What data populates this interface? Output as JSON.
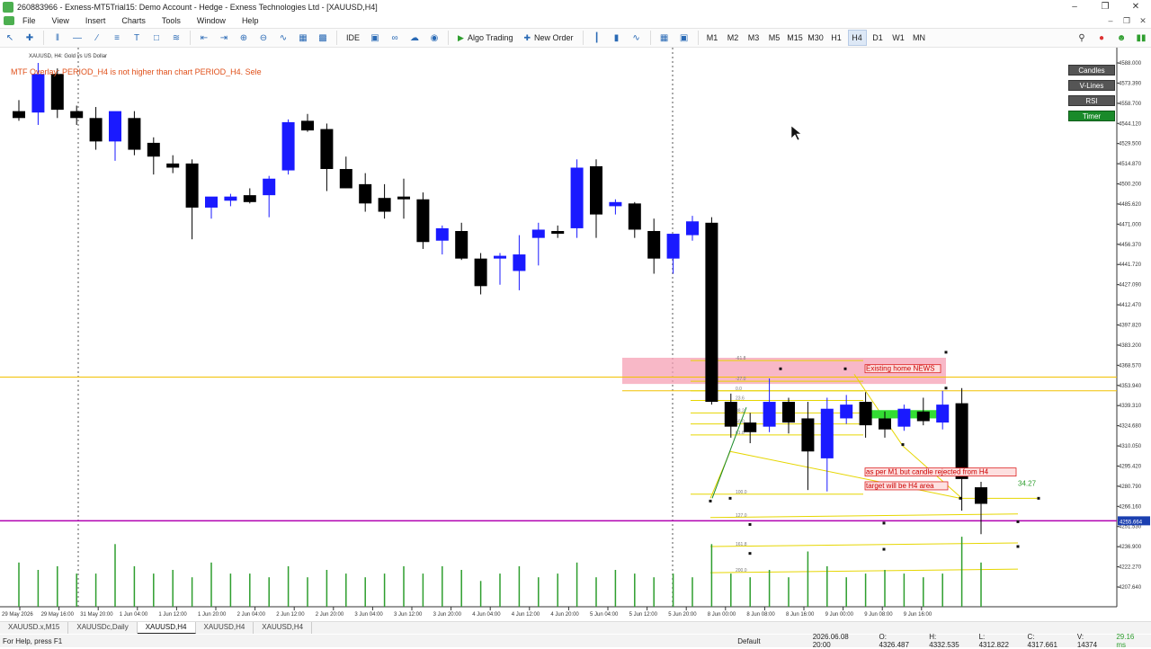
{
  "window": {
    "title": "260883966 - Exness-MT5Trial15: Demo Account - Hedge - Exness Technologies Ltd - [XAUUSD,H4]"
  },
  "menu": [
    "File",
    "View",
    "Insert",
    "Charts",
    "Tools",
    "Window",
    "Help"
  ],
  "toolbar": {
    "algo_trading": "Algo Trading",
    "new_order": "New Order",
    "ide": "IDE",
    "timeframes": [
      "M1",
      "M2",
      "M3",
      "M5",
      "M15",
      "M30",
      "H1",
      "H4",
      "D1",
      "W1",
      "MN"
    ],
    "active_tf": "H4"
  },
  "chart": {
    "symbol_label": "XAUUSD, H4:  Gold vs US Dollar",
    "warning": "MTF Overlay: PERIOD_H4 is not higher than chart PERIOD_H4. Sele",
    "colors": {
      "bull": "#1a1aff",
      "bear": "#000000",
      "price_line": "#b000b0",
      "zone": "#f5a0b4",
      "fib": "#e6d600",
      "volume": "#2e9e2e"
    },
    "indicator_buttons": [
      "Candles",
      "V-Lines",
      "RSI",
      "Timer"
    ],
    "current_price": "4255.664",
    "annotations": [
      "Existing home NEWS",
      "as per M1 but candle rejected from H4",
      "target will be H4 area",
      "34.27"
    ],
    "price_axis": [
      "4588.000",
      "4573.390",
      "4558.700",
      "4544.120",
      "4529.500",
      "4514.870",
      "4500.200",
      "4485.620",
      "4471.000",
      "4456.370",
      "4441.720",
      "4427.090",
      "4412.470",
      "4397.820",
      "4383.200",
      "4368.570",
      "4353.940",
      "4339.310",
      "4324.680",
      "4310.050",
      "4295.420",
      "4280.790",
      "4266.160",
      "4251.530",
      "4236.900",
      "4222.270",
      "4207.640"
    ],
    "time_axis": [
      "29 May 2026",
      "29 May 16:00",
      "31 May 20:00",
      "1 Jun 04:00",
      "1 Jun 12:00",
      "1 Jun 20:00",
      "2 Jun 04:00",
      "2 Jun 12:00",
      "2 Jun 20:00",
      "3 Jun 04:00",
      "3 Jun 12:00",
      "3 Jun 20:00",
      "4 Jun 04:00",
      "4 Jun 12:00",
      "4 Jun 20:00",
      "5 Jun 04:00",
      "5 Jun 12:00",
      "5 Jun 20:00",
      "8 Jun 00:00",
      "8 Jun 08:00",
      "8 Jun 16:00",
      "9 Jun 00:00",
      "9 Jun 08:00",
      "9 Jun 16:00"
    ],
    "fib_labels": [
      "-61.8",
      "-27.0",
      "0.0",
      "23.6",
      "38.2",
      "50.0",
      "61.8",
      "100.0",
      "127.0",
      "161.8",
      "200.0"
    ],
    "candles": [
      {
        "o": 4553,
        "h": 4561,
        "l": 4546,
        "c": 4548
      },
      {
        "o": 4552,
        "h": 4588,
        "l": 4543,
        "c": 4580
      },
      {
        "o": 4580,
        "h": 4584,
        "l": 4548,
        "c": 4554
      },
      {
        "o": 4553,
        "h": 4557,
        "l": 4543,
        "c": 4548
      },
      {
        "o": 4548,
        "h": 4556,
        "l": 4525,
        "c": 4531
      },
      {
        "o": 4531,
        "h": 4552,
        "l": 4517,
        "c": 4553
      },
      {
        "o": 4548,
        "h": 4553,
        "l": 4521,
        "c": 4525
      },
      {
        "o": 4530,
        "h": 4534,
        "l": 4507,
        "c": 4520
      },
      {
        "o": 4515,
        "h": 4521,
        "l": 4508,
        "c": 4512
      },
      {
        "o": 4515,
        "h": 4518,
        "l": 4460,
        "c": 4483
      },
      {
        "o": 4483,
        "h": 4490,
        "l": 4475,
        "c": 4491
      },
      {
        "o": 4488,
        "h": 4493,
        "l": 4484,
        "c": 4491
      },
      {
        "o": 4492,
        "h": 4497,
        "l": 4486,
        "c": 4487
      },
      {
        "o": 4492,
        "h": 4506,
        "l": 4476,
        "c": 4504
      },
      {
        "o": 4510,
        "h": 4547,
        "l": 4507,
        "c": 4545
      },
      {
        "o": 4546,
        "h": 4551,
        "l": 4538,
        "c": 4539
      },
      {
        "o": 4540,
        "h": 4544,
        "l": 4495,
        "c": 4511
      },
      {
        "o": 4511,
        "h": 4520,
        "l": 4497,
        "c": 4497
      },
      {
        "o": 4500,
        "h": 4508,
        "l": 4480,
        "c": 4486
      },
      {
        "o": 4490,
        "h": 4500,
        "l": 4475,
        "c": 4480
      },
      {
        "o": 4491,
        "h": 4504,
        "l": 4475,
        "c": 4489
      },
      {
        "o": 4489,
        "h": 4494,
        "l": 4453,
        "c": 4458
      },
      {
        "o": 4459,
        "h": 4470,
        "l": 4449,
        "c": 4468
      },
      {
        "o": 4466,
        "h": 4472,
        "l": 4445,
        "c": 4446
      },
      {
        "o": 4446,
        "h": 4450,
        "l": 4420,
        "c": 4426
      },
      {
        "o": 4446,
        "h": 4450,
        "l": 4427,
        "c": 4448
      },
      {
        "o": 4437,
        "h": 4463,
        "l": 4423,
        "c": 4449
      },
      {
        "o": 4461,
        "h": 4472,
        "l": 4441,
        "c": 4467
      },
      {
        "o": 4466,
        "h": 4470,
        "l": 4461,
        "c": 4464
      },
      {
        "o": 4468,
        "h": 4518,
        "l": 4461,
        "c": 4512
      },
      {
        "o": 4513,
        "h": 4518,
        "l": 4461,
        "c": 4478
      },
      {
        "o": 4484,
        "h": 4489,
        "l": 4478,
        "c": 4487
      },
      {
        "o": 4486,
        "h": 4487,
        "l": 4461,
        "c": 4467
      },
      {
        "o": 4466,
        "h": 4475,
        "l": 4435,
        "c": 4446
      },
      {
        "o": 4446,
        "h": 4462,
        "l": 4435,
        "c": 4464
      },
      {
        "o": 4463,
        "h": 4477,
        "l": 4459,
        "c": 4473
      },
      {
        "o": 4472,
        "h": 4476,
        "l": 4340,
        "c": 4342
      },
      {
        "o": 4342,
        "h": 4348,
        "l": 4316,
        "c": 4324
      },
      {
        "o": 4327,
        "h": 4334,
        "l": 4312,
        "c": 4320
      },
      {
        "o": 4324,
        "h": 4359,
        "l": 4320,
        "c": 4342
      },
      {
        "o": 4342,
        "h": 4345,
        "l": 4319,
        "c": 4327
      },
      {
        "o": 4330,
        "h": 4342,
        "l": 4278,
        "c": 4306
      },
      {
        "o": 4301,
        "h": 4345,
        "l": 4277,
        "c": 4337
      },
      {
        "o": 4330,
        "h": 4347,
        "l": 4326,
        "c": 4340
      },
      {
        "o": 4342,
        "h": 4349,
        "l": 4316,
        "c": 4325
      },
      {
        "o": 4330,
        "h": 4335,
        "l": 4316,
        "c": 4322
      },
      {
        "o": 4324,
        "h": 4340,
        "l": 4321,
        "c": 4337
      },
      {
        "o": 4335,
        "h": 4345,
        "l": 4325,
        "c": 4328
      },
      {
        "o": 4327,
        "h": 4350,
        "l": 4322,
        "c": 4340
      },
      {
        "o": 4341,
        "h": 4352,
        "l": 4263,
        "c": 4286
      },
      {
        "o": 4280,
        "h": 4284,
        "l": 4246,
        "c": 4268
      }
    ],
    "volumes": [
      60,
      50,
      55,
      45,
      45,
      85,
      55,
      45,
      50,
      40,
      60,
      45,
      45,
      40,
      55,
      40,
      50,
      45,
      40,
      45,
      55,
      45,
      55,
      50,
      35,
      45,
      55,
      40,
      45,
      60,
      40,
      50,
      45,
      40,
      45,
      40,
      85,
      45,
      40,
      50,
      40,
      75,
      55,
      40,
      45,
      50,
      45,
      40,
      45,
      95,
      60
    ]
  },
  "tabs": [
    "XAUUSD.x,M15",
    "XAUUSDc,Daily",
    "XAUUSD,H4",
    "XAUUSD,H4",
    "XAUUSD,H4"
  ],
  "active_tab": 2,
  "status": {
    "help": "For Help, press F1",
    "profile": "Default",
    "datetime": "2026.06.08 20:00",
    "open": "O: 4326.487",
    "high": "H: 4332.535",
    "low": "L: 4312.822",
    "close": "C: 4317.661",
    "volume": "V: 14374",
    "net": "29.16 ms"
  }
}
